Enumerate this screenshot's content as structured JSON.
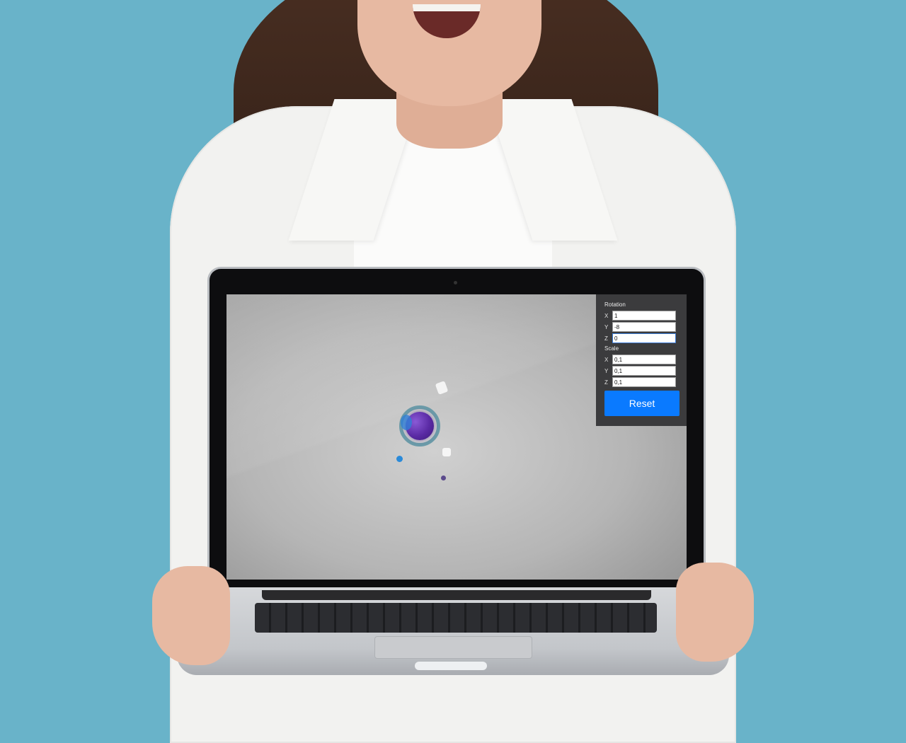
{
  "controls": {
    "rotation": {
      "title": "Rotation",
      "x_label": "X",
      "x_value": "1",
      "y_label": "Y",
      "y_value": "-8",
      "z_label": "Z",
      "z_value": "0"
    },
    "scale": {
      "title": "Scale",
      "x_label": "X",
      "x_value": "0,1",
      "y_label": "Y",
      "y_value": "0,1",
      "z_label": "Z",
      "z_value": "0,1"
    },
    "reset_label": "Reset"
  },
  "colors": {
    "background": "#69b3c9",
    "panel": "#3b3b3d",
    "reset_button": "#0a7aff",
    "globe": "#5a2aa4"
  }
}
